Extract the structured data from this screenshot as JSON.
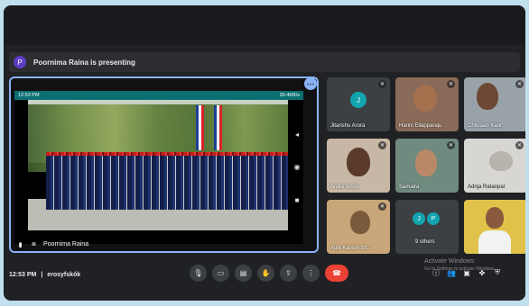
{
  "presenting": {
    "avatar_letter": "P",
    "text": "Poornima Raina is presenting"
  },
  "phone": {
    "time": "12:53 PM",
    "network": "39.4KB/s"
  },
  "main_tile": {
    "presenter_name": "Poornima Raina"
  },
  "participants": [
    {
      "name": "Jitanshu Arora",
      "initial": "J",
      "avatar_color": "#12a4af"
    },
    {
      "name": "Harini Ellapparaju"
    },
    {
      "name": "Chitvaan Kaur"
    },
    {
      "name": "Anika Arora"
    },
    {
      "name": "Samaira"
    },
    {
      "name": "Adrija Ratanpal"
    },
    {
      "name": "Aditi Kanish Sh..."
    },
    {
      "name": "9 others",
      "initials": [
        "J",
        "P"
      ]
    },
    {
      "name": ""
    }
  ],
  "bottom": {
    "clock": "12:53 PM",
    "separator": "|",
    "meeting_code": "erosyfskók"
  },
  "watermark": {
    "title": "Activate Windows",
    "subtitle": "Go to Settings to activate Windows."
  },
  "colors": {
    "accent": "#8ab4f8",
    "end_call": "#ea4335",
    "bg": "#202124"
  }
}
